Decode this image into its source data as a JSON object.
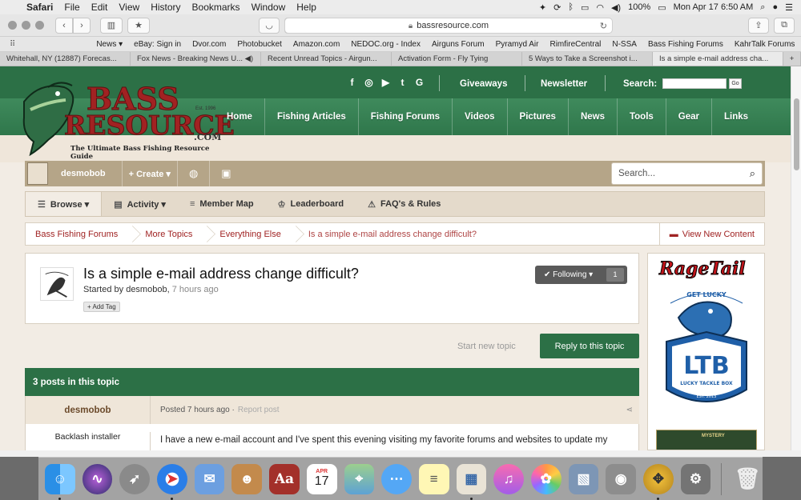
{
  "menubar": {
    "app": "Safari",
    "items": [
      "File",
      "Edit",
      "View",
      "History",
      "Bookmarks",
      "Window",
      "Help"
    ],
    "battery": "100%",
    "datetime": "Mon Apr 17  6:50 AM"
  },
  "toolbar": {
    "url": "bassresource.com"
  },
  "favorites": [
    "News ▾",
    "eBay: Sign in",
    "Dvor.com",
    "Photobucket",
    "Amazon.com",
    "NEDOC.org - Index",
    "Airguns Forum",
    "Pyramyd Air",
    "RimfireCentral",
    "N-SSA",
    "Bass Fishing Forums",
    "KahrTalk Forums"
  ],
  "tabs": [
    "Whitehall, NY (12887) Forecas...",
    "Fox News - Breaking News U... ◀)",
    "Recent Unread Topics - Airgun...",
    "Activation Form - Fly Tying",
    "5 Ways to Take a Screenshot i...",
    "Is a simple e-mail address cha..."
  ],
  "tab_add": "+",
  "site": {
    "logo": {
      "word1": "BASS",
      "word2": "RESOURCE",
      "dotcom": ".COM",
      "est": "Est. 1996",
      "tagline": "The Ultimate Bass Fishing Resource Guide"
    },
    "social": [
      "f",
      "◎",
      "▶",
      "t",
      "G"
    ],
    "toplinks": {
      "giveaways": "Giveaways",
      "newsletter": "Newsletter",
      "search": "Search:",
      "go": "Go"
    },
    "nav": [
      "Home",
      "Fishing Articles",
      "Fishing Forums",
      "Videos",
      "Pictures",
      "News",
      "Tools",
      "Gear",
      "Links"
    ]
  },
  "userbar": {
    "username": "desmobob",
    "create": "+ Create ▾",
    "search_placeholder": "Search..."
  },
  "subnav": [
    {
      "icon": "☰",
      "label": "Browse ▾"
    },
    {
      "icon": "▤",
      "label": "Activity ▾"
    },
    {
      "icon": "≡",
      "label": "Member Map"
    },
    {
      "icon": "♔",
      "label": "Leaderboard"
    },
    {
      "icon": "⚠",
      "label": "FAQ's & Rules"
    }
  ],
  "breadcrumb": [
    "Bass Fishing Forums",
    "More Topics",
    "Everything Else",
    "Is a simple e-mail address change difficult?"
  ],
  "view_new": "View New Content",
  "topic": {
    "title": "Is a simple e-mail address change difficult?",
    "started_by": "Started by desmobob,",
    "ago": "7 hours ago",
    "add_tag": "+ Add Tag",
    "following": "✔ Following ▾",
    "follow_count": "1"
  },
  "actions": {
    "start_new": "Start new topic",
    "reply": "Reply to this topic"
  },
  "posts": {
    "header": "3 posts in this topic",
    "first": {
      "author": "desmobob",
      "posted": "Posted 7 hours ago ·",
      "report": "Report post",
      "role": "Backlash installer",
      "body": "I have a new e-mail account and I've spent this evening visiting my favorite forums and websites to update my"
    }
  },
  "ad": {
    "brand": "RageTail",
    "get_lucky": "GET LUCKY",
    "ltb": "LTB",
    "ltb_sub": "LUCKY TACKLE BOX",
    "est": "EST. 2013",
    "mystery": "MYSTERY"
  },
  "dock": [
    "Finder",
    "Siri",
    "Launchpad",
    "Safari",
    "Mail",
    "Contacts",
    "Dictionary",
    "Calendar",
    "Maps",
    "Messages",
    "Notes",
    "Preview",
    "iTunes",
    "Photos",
    "Image Capture",
    "Screenshot",
    "Compass",
    "System Preferences",
    "Trash"
  ],
  "dock_calendar_month": "APR",
  "dock_calendar_day": "17"
}
